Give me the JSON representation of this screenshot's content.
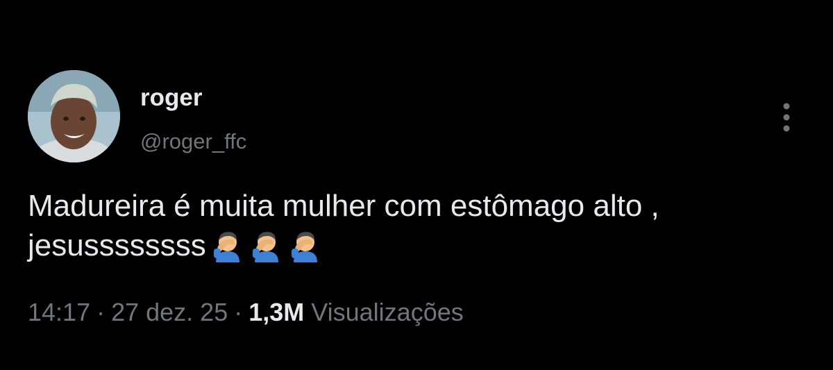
{
  "author": {
    "display_name": "roger",
    "handle": "@roger_ffc",
    "avatar_icon": "profile-photo"
  },
  "tweet": {
    "text": "Madureira é muita mulher com estômago alto , jesussssssss",
    "emoji": [
      "man-facepalming",
      "man-facepalming",
      "man-facepalming"
    ]
  },
  "meta": {
    "time": "14:17",
    "separator": "·",
    "date": "27 dez. 25",
    "views_count": "1,3M",
    "views_label": "Visualizações"
  },
  "colors": {
    "background": "#000000",
    "primary_text": "#e7e9ea",
    "secondary_text": "#71767b"
  },
  "menu": {
    "icon": "more-vertical-icon"
  }
}
